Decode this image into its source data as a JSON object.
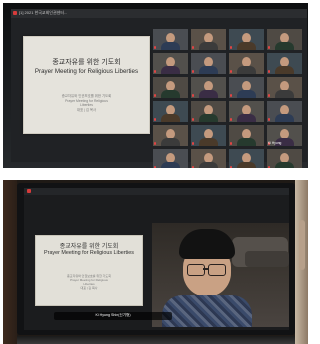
{
  "top_photo": {
    "window_title": "[1] 2021 한국교회인권센터...",
    "slide": {
      "title_ko": "종교자유를 위한 기도회",
      "title_en": "Prayer Meeting for Religious Liberties",
      "details": [
        "종교자유와 인권보호를 위한 기도회",
        "Prayer Meeting for Religious",
        "Liberties",
        "대표 | 김 목사"
      ]
    },
    "participants": [
      {
        "name": "",
        "kind": "person"
      },
      {
        "name": "",
        "kind": "person"
      },
      {
        "name": "",
        "kind": "person"
      },
      {
        "name": "",
        "kind": "person"
      },
      {
        "name": "",
        "kind": "person"
      },
      {
        "name": "",
        "kind": "person"
      },
      {
        "name": "",
        "kind": "person"
      },
      {
        "name": "",
        "kind": "person"
      },
      {
        "name": "",
        "kind": "person"
      },
      {
        "name": "",
        "kind": "person"
      },
      {
        "name": "",
        "kind": "person"
      },
      {
        "name": "",
        "kind": "person"
      },
      {
        "name": "",
        "kind": "person"
      },
      {
        "name": "",
        "kind": "person"
      },
      {
        "name": "",
        "kind": "person"
      },
      {
        "name": "",
        "kind": "person"
      },
      {
        "name": "",
        "kind": "person"
      },
      {
        "name": "",
        "kind": "person"
      },
      {
        "name": "",
        "kind": "person"
      },
      {
        "name": "Ki Hyung",
        "kind": "person"
      },
      {
        "name": "",
        "kind": "person"
      },
      {
        "name": "",
        "kind": "person"
      },
      {
        "name": "",
        "kind": "person"
      },
      {
        "name": "",
        "kind": "person"
      },
      {
        "name": "",
        "kind": "person"
      },
      {
        "name": "",
        "kind": "person"
      },
      {
        "name": "이수경",
        "kind": "dark"
      },
      {
        "name": "",
        "kind": "logo"
      },
      {
        "name": "KCCC Fellowship",
        "kind": "dark"
      },
      {
        "name": "",
        "kind": "logo"
      }
    ]
  },
  "bottom_photo": {
    "slide": {
      "title_ko": "종교자유를 위한 기도회",
      "title_en": "Prayer Meeting for Religious Liberties",
      "details": [
        "종교자유와 인권보호를 위한 기도회",
        "Prayer Meeting for Religious",
        "Liberties",
        "대표 | 김 목사"
      ]
    },
    "speaker_caption": "Ki Hyung Shin(신기형)"
  },
  "colors": {
    "zoom_bg": "#202225",
    "slide_bg": "#e5e3dc",
    "recording_red": "#d63b3b",
    "logo_pink": "#c62a6e"
  }
}
